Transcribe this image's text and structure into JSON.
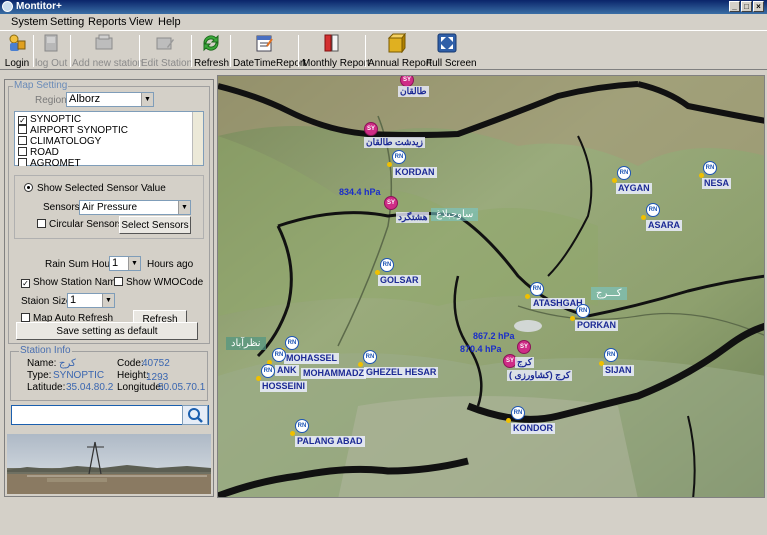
{
  "window": {
    "title": "Montitor+"
  },
  "menu": [
    "System",
    "Setting",
    "Reports",
    "View",
    "Help"
  ],
  "toolbar": {
    "login": "Login",
    "logout": "log Out",
    "add_station": "Add new station",
    "edit_station": "Edit Station",
    "refresh": "Refresh",
    "datetime_report": "DateTimeReport",
    "monthly_report": "Monthly Report",
    "annual_report": "Annual Report",
    "full_screen": "Full Screen"
  },
  "map_setting": {
    "legend": "Map Setting",
    "region_label": "Region",
    "region_value": "Alborz",
    "station_types": [
      {
        "label": "SYNOPTIC",
        "checked": true
      },
      {
        "label": "AIRPORT SYNOPTIC",
        "checked": false
      },
      {
        "label": "CLIMATOLOGY",
        "checked": false
      },
      {
        "label": "ROAD",
        "checked": false
      },
      {
        "label": "AGROMET",
        "checked": false
      }
    ],
    "show_selected_sensor": "Show Selected Sensor Value",
    "sensors_label": "Sensors:",
    "sensors_value": "Air Pressure",
    "circular_sensors": "Circular  Sensors",
    "select_sensors": "Select Sensors",
    "rain_sum_label": "Rain Sum Hours:",
    "rain_sum_value": "1",
    "hours_ago": "Hours ago",
    "show_station_name": "Show Station Name",
    "show_wmo_code": "Show WMOCode",
    "station_size_label": "Staion Size:",
    "station_size_value": "1",
    "map_auto_refresh": "Map Auto Refresh",
    "refresh_button": "Refresh",
    "save_default": "Save setting as default"
  },
  "station_info": {
    "legend": "Station Info",
    "name_label": "Name:",
    "name_value": "کرج",
    "code_label": "Code:",
    "code_value": "40752",
    "type_label": "Type:",
    "type_value": "SYNOPTIC",
    "height_label": "Height:",
    "height_value": "1293",
    "latitude_label": "Latitude:",
    "latitude_value": "35.04.80.2",
    "longitude_label": "Longitude:",
    "longitude_value": "50.05.70.1"
  },
  "search": {
    "value": ""
  },
  "map": {
    "icon_rn": "RN",
    "icon_sy": "SY",
    "stations": [
      {
        "name": "KORDAN"
      },
      {
        "name": "AYGAN"
      },
      {
        "name": "NESA"
      },
      {
        "name": "ASARA"
      },
      {
        "name": "GOLSAR"
      },
      {
        "name": "ATASHGAH"
      },
      {
        "name": "PORKAN"
      },
      {
        "name": "MOHASSEL"
      },
      {
        "name": "ANK"
      },
      {
        "name": "MOHAMMADZ"
      },
      {
        "name": "GHEZEL HESAR"
      },
      {
        "name": "HOSSEINI"
      },
      {
        "name": "SIJAN"
      },
      {
        "name": "KONDOR"
      },
      {
        "name": "PALANG ABAD"
      }
    ],
    "farsi_labels": {
      "taleghan": "طالقان",
      "zidasht": "زیدشت طالقان",
      "hashtgerd": "هشتگرد",
      "karaj": "کرج",
      "karaj_agri": "( کرج (کشاورزی"
    },
    "pressures": {
      "hashtgerd": "834.4 hPa",
      "karaj": "867.2 hPa",
      "karaj_agri": "870.4 hPa"
    },
    "city_labels": {
      "savojbolagh": "ساوجبلاغ",
      "karaj": "کـــرج",
      "nazarabad": "نظرآباد"
    }
  }
}
